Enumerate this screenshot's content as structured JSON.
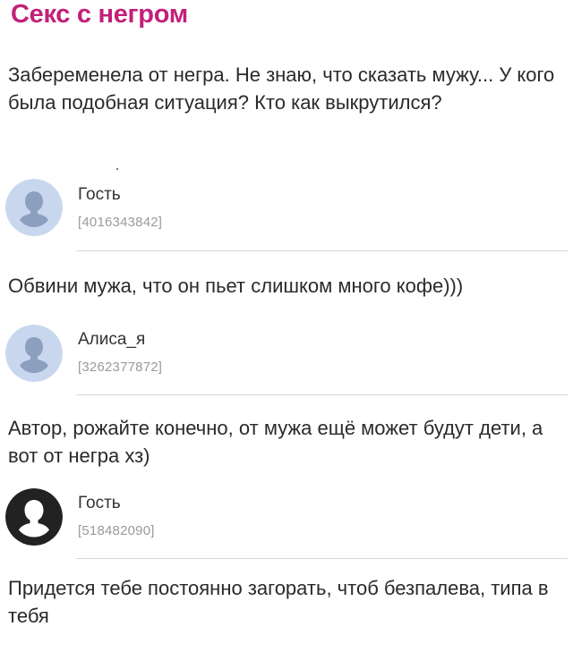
{
  "post": {
    "title": "Секс с негром",
    "body": "Забеременела от негра. Не знаю, что сказать мужу... У кого была подобная ситуация? Кто как выкрутился?"
  },
  "comments": [
    {
      "author": "Гость",
      "uid": "[4016343842]",
      "text": "Обвини мужа, что он пьет слишком много кофе)))",
      "avatar_style": "light"
    },
    {
      "author": "Алиса_я",
      "uid": "[3262377872]",
      "text": "Автор, рожайте конечно, от мужа ещё может будут дети, а вот от негра хз)",
      "avatar_style": "light"
    },
    {
      "author": "Гость",
      "uid": "[518482090]",
      "text": "Придется тебе постоянно загорать, чтоб безпалева, типа в тебя",
      "avatar_style": "dark"
    }
  ],
  "colors": {
    "title": "#c2207a",
    "avatar_light_bg": "#c9d7ee",
    "avatar_light_fg": "#8c9fbf",
    "avatar_dark_bg": "#222222",
    "avatar_dark_fg": "#ffffff"
  },
  "icons": {
    "avatar": "user-silhouette-icon"
  }
}
